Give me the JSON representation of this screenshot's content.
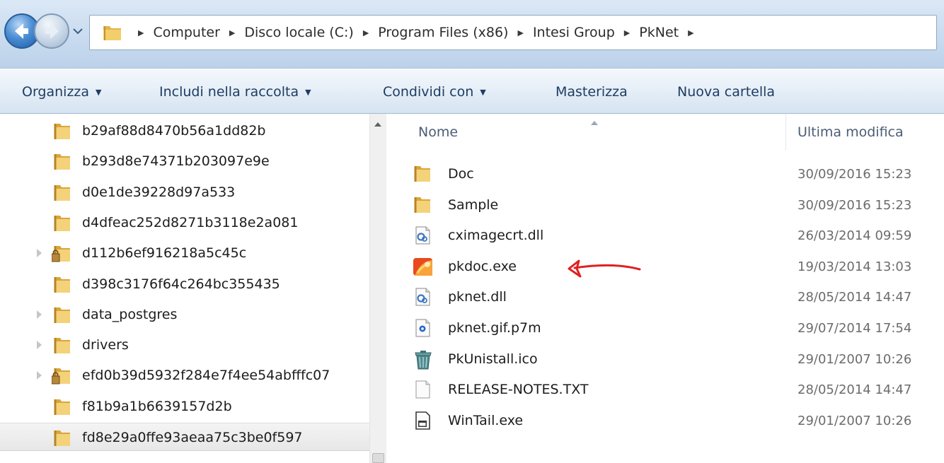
{
  "address_bar": {
    "breadcrumbs": [
      "Computer",
      "Disco locale (C:)",
      "Program Files (x86)",
      "Intesi Group",
      "PkNet"
    ]
  },
  "toolbar": {
    "organize": "Organizza",
    "include_in_library": "Includi nella raccolta",
    "share_with": "Condividi con",
    "burn": "Masterizza",
    "new_folder": "Nuova cartella"
  },
  "nav_tree": {
    "items": [
      {
        "label": "b29af88d8470b56a1dd82b",
        "icon": "folder-icon",
        "expandable": false,
        "selected": false
      },
      {
        "label": "b293d8e74371b203097e9e",
        "icon": "folder-icon",
        "expandable": false,
        "selected": false
      },
      {
        "label": "d0e1de39228d97a533",
        "icon": "folder-icon",
        "expandable": false,
        "selected": false
      },
      {
        "label": "d4dfeac252d8271b3118e2a081",
        "icon": "folder-icon",
        "expandable": false,
        "selected": false
      },
      {
        "label": "d112b6ef916218a5c45c",
        "icon": "locked-folder-icon",
        "expandable": true,
        "selected": false
      },
      {
        "label": "d398c3176f64c264bc355435",
        "icon": "folder-icon",
        "expandable": false,
        "selected": false
      },
      {
        "label": "data_postgres",
        "icon": "folder-icon",
        "expandable": true,
        "selected": false
      },
      {
        "label": "drivers",
        "icon": "folder-icon",
        "expandable": true,
        "selected": false
      },
      {
        "label": "efd0b39d5932f284e7f4ee54abfffc07",
        "icon": "locked-folder-icon",
        "expandable": true,
        "selected": false
      },
      {
        "label": "f81b9a1b6639157d2b",
        "icon": "folder-icon",
        "expandable": false,
        "selected": false
      },
      {
        "label": "fd8e29a0ffe93aeaa75c3be0f597",
        "icon": "folder-icon",
        "expandable": false,
        "selected": true
      }
    ]
  },
  "file_list": {
    "columns": {
      "name": "Nome",
      "modified": "Ultima modifica"
    },
    "rows": [
      {
        "name": "Doc",
        "modified": "30/09/2016 15:23",
        "icon": "folder-icon"
      },
      {
        "name": "Sample",
        "modified": "30/09/2016 15:23",
        "icon": "folder-icon"
      },
      {
        "name": "cximagecrt.dll",
        "modified": "26/03/2014 09:59",
        "icon": "dll-icon"
      },
      {
        "name": "pkdoc.exe",
        "modified": "19/03/2014 13:03",
        "icon": "app-icon"
      },
      {
        "name": "pknet.dll",
        "modified": "28/05/2014 14:47",
        "icon": "dll-icon"
      },
      {
        "name": "pknet.gif.p7m",
        "modified": "29/07/2014 17:54",
        "icon": "signed-file-icon"
      },
      {
        "name": "PkUnistall.ico",
        "modified": "29/01/2007 10:26",
        "icon": "recycle-bin-icon"
      },
      {
        "name": "RELEASE-NOTES.TXT",
        "modified": "28/05/2014 14:47",
        "icon": "text-file-icon"
      },
      {
        "name": "WinTail.exe",
        "modified": "29/01/2007 10:26",
        "icon": "exe-window-icon"
      }
    ]
  },
  "annotation": {
    "icon": "red-arrow-icon",
    "color": "#e02020"
  }
}
